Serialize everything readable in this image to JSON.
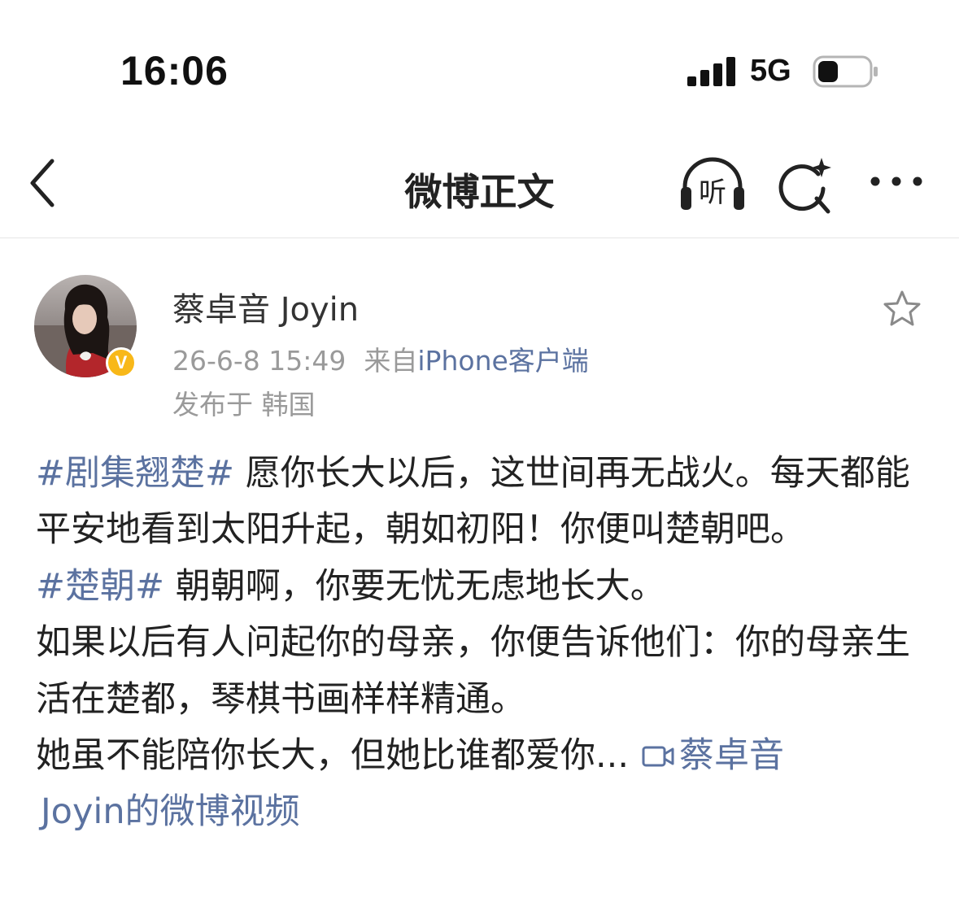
{
  "status_bar": {
    "time": "16:06",
    "network": "5G",
    "signal_bars": 4,
    "battery_level": 0.4
  },
  "nav": {
    "title": "微博正文",
    "listen_label": "听",
    "icons": {
      "back": "chevron-left-icon",
      "listen": "headphones-icon",
      "search": "search-sparkle-icon",
      "more": "more-dots-icon"
    }
  },
  "author": {
    "name": "蔡卓音 Joyin",
    "verified_badge": "V",
    "timestamp": "26-6-8 15:49",
    "source_prefix": "来自",
    "source_link": "iPhone客户端",
    "location": "发布于 韩国"
  },
  "post": {
    "hashtag1": "#剧集翘楚#",
    "line1_text": " 愿你长大以后，这世间再无战火。每天都能平安地看到太阳升起，朝如初阳！你便叫楚朝吧。",
    "hashtag2": "#楚朝#",
    "line2_text": " 朝朝啊，你要无忧无虑地长大。",
    "line3_text": "如果以后有人问起你的母亲，你便告诉他们：你的母亲生活在楚都，琴棋书画样样精通。",
    "line4_text": "她虽不能陪你长大，但她比谁都爱你...",
    "video_link_part1": "蔡卓音",
    "video_link_part2": "Joyin的微博视频"
  },
  "colors": {
    "link": "#5b72a0",
    "meta": "#9a9a9a",
    "text": "#222222",
    "badge": "#f8b819"
  }
}
